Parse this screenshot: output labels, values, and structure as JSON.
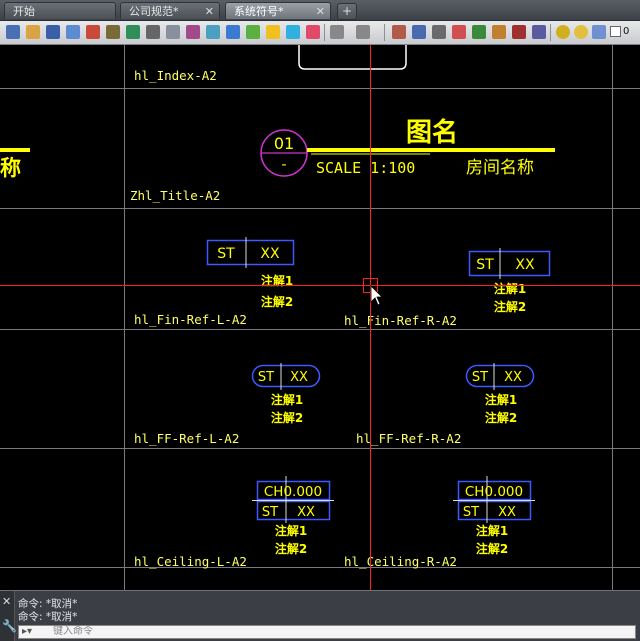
{
  "tabs": [
    {
      "label": "开始",
      "active": false
    },
    {
      "label": "公司规范*",
      "active": false
    },
    {
      "label": "系统符号*",
      "active": true
    }
  ],
  "toolbar": {
    "layer_number": "0",
    "icon_names": [
      "new-icon",
      "open-icon",
      "save-icon",
      "saveas-icon",
      "print-icon",
      "plot-icon",
      "publish-icon",
      "cut-icon",
      "copy-icon",
      "paste-icon",
      "match-icon",
      "block-icon",
      "hatch-icon",
      "text-icon",
      "undo-icon",
      "redo-icon",
      "pan-icon",
      "zoom-icon",
      "layer-icon",
      "properties-icon",
      "light-icon"
    ]
  },
  "symbols": {
    "index": {
      "label": "hl_Index-A2"
    },
    "title": {
      "label": "Zhl_Title-A2",
      "circle_number": "01",
      "circle_sub": "-",
      "drawing_name": "图名",
      "scale": "SCALE 1:100",
      "room_name": "房间名称",
      "partial_left_text": "称"
    },
    "fin_ref_left": {
      "label": "hl_Fin-Ref-L-A2",
      "code": "ST",
      "value": "XX",
      "note1": "注解1",
      "note2": "注解2"
    },
    "fin_ref_right": {
      "label": "hl_Fin-Ref-R-A2",
      "code": "ST",
      "value": "XX",
      "note1": "注解1",
      "note2": "注解2"
    },
    "ff_ref_left": {
      "label": "hl_FF-Ref-L-A2",
      "code": "ST",
      "value": "XX",
      "note1": "注解1",
      "note2": "注解2"
    },
    "ff_ref_right": {
      "label": "hl_FF-Ref-R-A2",
      "code": "ST",
      "value": "XX",
      "note1": "注解1",
      "note2": "注解2"
    },
    "ceiling_left": {
      "label": "hl_Ceiling-L-A2",
      "height": "CH0.000",
      "code": "ST",
      "value": "XX",
      "note1": "注解1",
      "note2": "注解2"
    },
    "ceiling_right": {
      "label": "hl_Ceiling-R-A2",
      "height": "CH0.000",
      "code": "ST",
      "value": "XX",
      "note1": "注解1",
      "note2": "注解2"
    }
  },
  "command": {
    "history": [
      "命令: *取消*",
      "命令: *取消*"
    ],
    "placeholder": "键入命令"
  },
  "colors": {
    "label": "#ffff66",
    "symbol_text": "#ffff00",
    "frame": "#3b5bff",
    "circle": "#cc33cc",
    "crosshair": "#ff2020",
    "grid": "#7a7a7a"
  }
}
